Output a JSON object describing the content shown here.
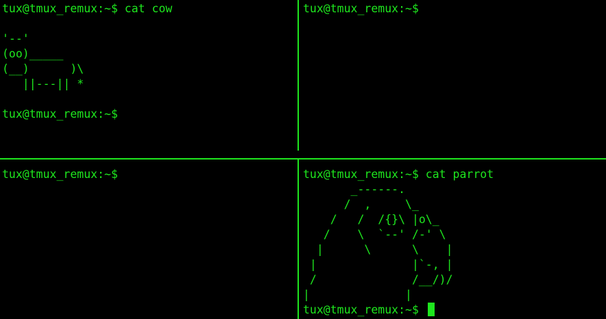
{
  "colors": {
    "foreground": "#1ee61e",
    "background": "#000000"
  },
  "panes": {
    "top_left": {
      "lines": [
        "tux@tmux_remux:~$ cat cow",
        "",
        "'--'",
        "(oo)_____",
        "(__)      )\\",
        "   ||---|| *",
        "",
        "tux@tmux_remux:~$"
      ]
    },
    "top_right": {
      "lines": [
        "tux@tmux_remux:~$"
      ]
    },
    "bottom_left": {
      "lines": [
        "tux@tmux_remux:~$"
      ]
    },
    "bottom_right": {
      "lines": [
        "tux@tmux_remux:~$ cat parrot",
        "       _------.",
        "      /  ,     \\_",
        "    /   /  /{}\\ |o\\_",
        "   /    \\  `--' /-' \\",
        "  |      \\      \\    |",
        " |              |`-, |",
        " /              /__/)/",
        "|              |"
      ],
      "prompt": "tux@tmux_remux:~$"
    }
  }
}
